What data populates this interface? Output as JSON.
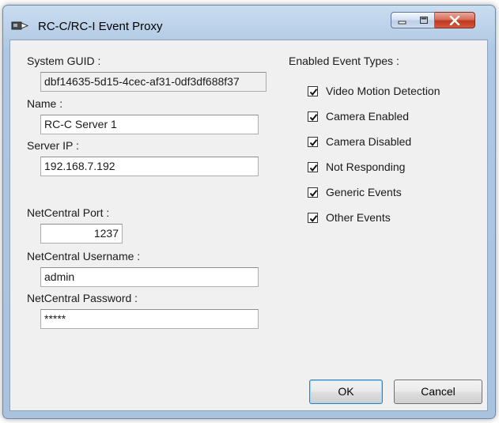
{
  "window": {
    "title": "RC-C/RC-I Event Proxy"
  },
  "form": {
    "guid_label": "System GUID :",
    "guid_value": "dbf14635-5d15-4cec-af31-0df3df688f37",
    "name_label": "Name :",
    "name_value": "RC-C Server 1",
    "server_ip_label": "Server IP :",
    "server_ip_value": "192.168.7.192",
    "port_label": "NetCentral Port :",
    "port_value": "1237",
    "username_label": "NetCentral Username :",
    "username_value": "admin",
    "password_label": "NetCentral Password :",
    "password_value": "*****"
  },
  "events": {
    "heading": "Enabled Event Types :",
    "items": [
      {
        "label": "Video Motion Detection",
        "checked": true
      },
      {
        "label": "Camera Enabled",
        "checked": true
      },
      {
        "label": "Camera Disabled",
        "checked": true
      },
      {
        "label": "Not Responding",
        "checked": true
      },
      {
        "label": "Generic Events",
        "checked": true
      },
      {
        "label": "Other Events",
        "checked": true
      }
    ]
  },
  "buttons": {
    "ok": "OK",
    "cancel": "Cancel"
  },
  "icons": {
    "app": "camera-arrow-icon",
    "minimize": "minimize-icon",
    "maximize": "maximize-icon",
    "close": "close-icon"
  }
}
